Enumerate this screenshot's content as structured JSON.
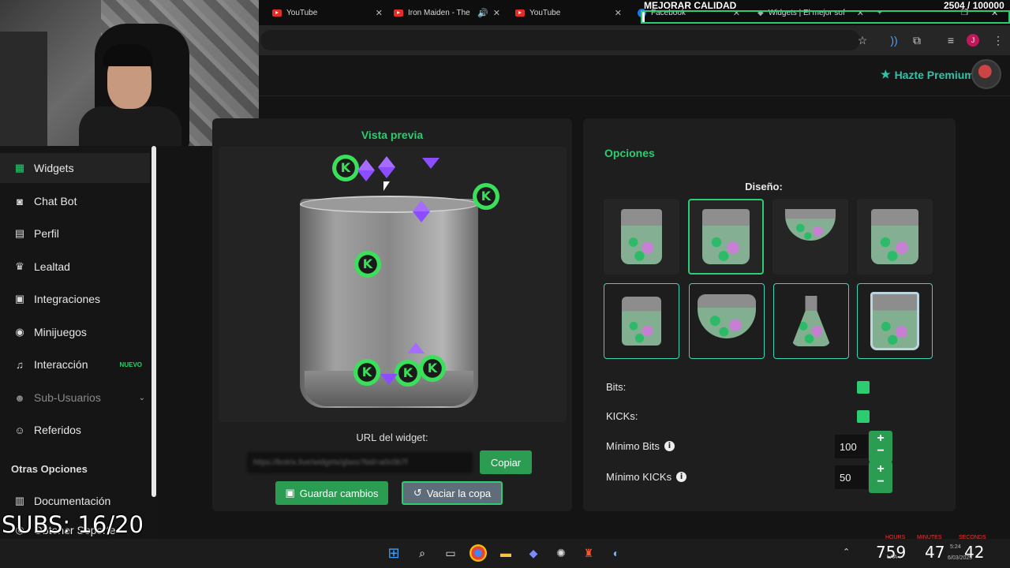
{
  "browser": {
    "tabs": [
      {
        "label": "YouTube"
      },
      {
        "label": "Iron Maiden - The"
      },
      {
        "label": "YouTube"
      },
      {
        "label": "Facebook"
      },
      {
        "label": "Widgets | El mejor sof"
      }
    ],
    "new_tab": "+"
  },
  "overlay": {
    "improve_quality": "MEJORAR CALIDAD",
    "goal": "2504 / 100000",
    "subs": "SUBS: 16/20"
  },
  "header": {
    "premium_label": "Hazte Premium"
  },
  "sidebar": {
    "items": [
      {
        "label": "Widgets",
        "icon": "grid-icon"
      },
      {
        "label": "Chat Bot",
        "icon": "robot-icon"
      },
      {
        "label": "Perfil",
        "icon": "id-card-icon"
      },
      {
        "label": "Lealtad",
        "icon": "trophy-icon"
      },
      {
        "label": "Integraciones",
        "icon": "plug-icon"
      },
      {
        "label": "Minijuegos",
        "icon": "gamepad-icon"
      },
      {
        "label": "Interacción",
        "icon": "music-icon",
        "badge": "NUEVO"
      },
      {
        "label": "Sub-Usuarios",
        "icon": "users-icon"
      },
      {
        "label": "Referidos",
        "icon": "user-plus-icon"
      }
    ],
    "section_title": "Otras Opciones",
    "extra_items": [
      {
        "label": "Documentación",
        "icon": "book-icon"
      },
      {
        "label": "Obtener Soporte",
        "icon": "support-icon"
      }
    ]
  },
  "preview": {
    "title": "Vista previa",
    "url_label": "URL del widget:",
    "url_value": "https://botrix.live/widgets/glass?bid=a0c0b7f",
    "copy_label": "Copiar",
    "save_label": "Guardar cambios",
    "empty_label": "Vaciar la copa"
  },
  "options": {
    "title": "Opciones",
    "design_label": "Diseño:",
    "designs_selected_index": 1,
    "bits_label": "Bits:",
    "kicks_label": "KICKs:",
    "bits_checked": true,
    "kicks_checked": true,
    "min_bits_label": "Mínimo Bits",
    "min_bits_value": "100",
    "min_kicks_label": "Mínimo KICKs",
    "min_kicks_value": "50",
    "plus": "+",
    "minus": "−",
    "info": "i"
  },
  "taskbar": {
    "time": "5:24",
    "date": "6/03/2025",
    "lang": "LAA",
    "stat1": "759",
    "stat2": "47",
    "stat3": "42",
    "label_hours": "HOURS",
    "label_minutes": "MINUTES",
    "label_seconds": "SECONDS"
  },
  "colors": {
    "accent": "#2ecc71",
    "teal": "#2ec4a8",
    "button_green": "#2a9d53"
  }
}
